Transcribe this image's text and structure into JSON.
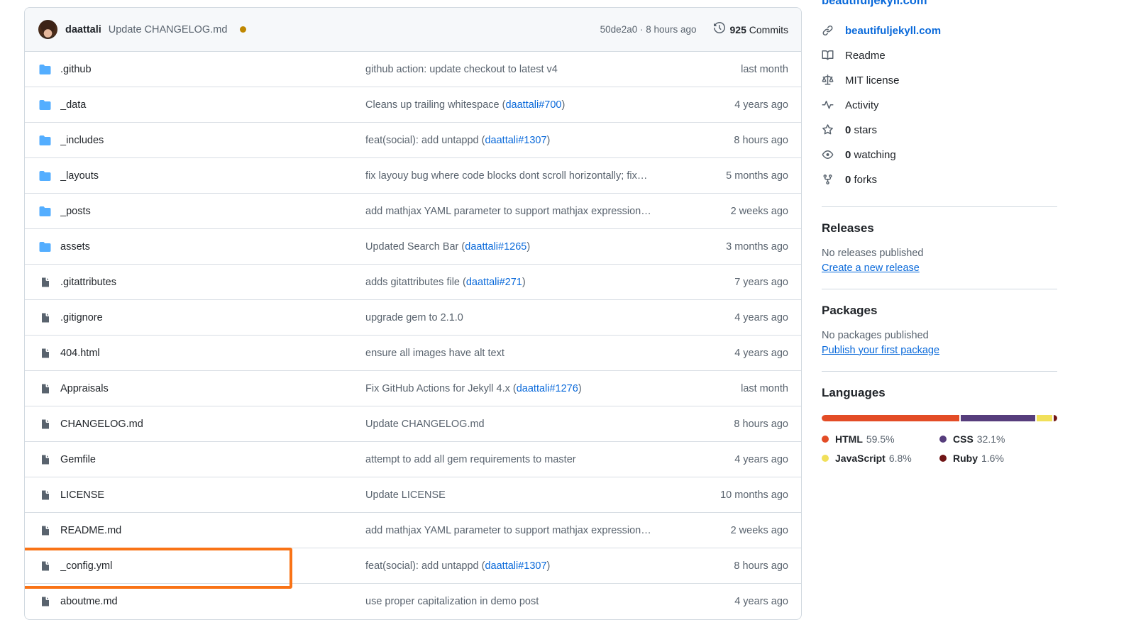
{
  "latest_commit": {
    "author": "daattali",
    "message": "Update CHANGELOG.md",
    "status_dot_color": "#bf8700",
    "sha_and_time": "50de2a0 · 8 hours ago",
    "commits_count": "925",
    "commits_label": "Commits"
  },
  "files": [
    {
      "icon": "folder-icon",
      "name": ".github",
      "message_prefix": "github action: update checkout to latest v4",
      "issue": "",
      "message_suffix": "",
      "time": "last month"
    },
    {
      "icon": "folder-icon",
      "name": "_data",
      "message_prefix": "Cleans up trailing whitespace (",
      "issue": "daattali#700",
      "message_suffix": ")",
      "time": "4 years ago"
    },
    {
      "icon": "folder-icon",
      "name": "_includes",
      "message_prefix": "feat(social): add untappd (",
      "issue": "daattali#1307",
      "message_suffix": ")",
      "time": "8 hours ago"
    },
    {
      "icon": "folder-icon",
      "name": "_layouts",
      "message_prefix": "fix layouy bug where code blocks dont scroll horizontally; fix…",
      "issue": "",
      "message_suffix": "",
      "time": "5 months ago"
    },
    {
      "icon": "folder-icon",
      "name": "_posts",
      "message_prefix": "add mathjax YAML parameter to support mathjax expression…",
      "issue": "",
      "message_suffix": "",
      "time": "2 weeks ago"
    },
    {
      "icon": "folder-icon",
      "name": "assets",
      "message_prefix": "Updated Search Bar (",
      "issue": "daattali#1265",
      "message_suffix": ")",
      "time": "3 months ago"
    },
    {
      "icon": "file-icon",
      "name": ".gitattributes",
      "message_prefix": "adds gitattributes file (",
      "issue": "daattali#271",
      "message_suffix": ")",
      "time": "7 years ago"
    },
    {
      "icon": "file-icon",
      "name": ".gitignore",
      "message_prefix": "upgrade gem to 2.1.0",
      "issue": "",
      "message_suffix": "",
      "time": "4 years ago"
    },
    {
      "icon": "file-icon",
      "name": "404.html",
      "message_prefix": "ensure all images have alt text",
      "issue": "",
      "message_suffix": "",
      "time": "4 years ago"
    },
    {
      "icon": "file-icon",
      "name": "Appraisals",
      "message_prefix": "Fix GitHub Actions for Jekyll 4.x (",
      "issue": "daattali#1276",
      "message_suffix": ")",
      "time": "last month"
    },
    {
      "icon": "file-icon",
      "name": "CHANGELOG.md",
      "message_prefix": "Update CHANGELOG.md",
      "issue": "",
      "message_suffix": "",
      "time": "8 hours ago"
    },
    {
      "icon": "file-icon",
      "name": "Gemfile",
      "message_prefix": "attempt to add all gem requirements to master",
      "issue": "",
      "message_suffix": "",
      "time": "4 years ago"
    },
    {
      "icon": "file-icon",
      "name": "LICENSE",
      "message_prefix": "Update LICENSE",
      "issue": "",
      "message_suffix": "",
      "time": "10 months ago"
    },
    {
      "icon": "file-icon",
      "name": "README.md",
      "message_prefix": "add mathjax YAML parameter to support mathjax expression…",
      "issue": "",
      "message_suffix": "",
      "time": "2 weeks ago"
    },
    {
      "icon": "file-icon",
      "name": "_config.yml",
      "message_prefix": "feat(social): add untappd (",
      "issue": "daattali#1307",
      "message_suffix": ")",
      "time": "8 hours ago",
      "highlighted": true
    },
    {
      "icon": "file-icon",
      "name": "aboutme.md",
      "message_prefix": "use proper capitalization in demo post",
      "issue": "",
      "message_suffix": "",
      "time": "4 years ago"
    }
  ],
  "highlight_color": "#f97316",
  "sidebar": {
    "site_link_top": "beautifuljekyll.com",
    "about_items": [
      {
        "icon": "link-icon",
        "text": "beautifuljekyll.com",
        "is_link": true
      },
      {
        "icon": "book-icon",
        "text": "Readme"
      },
      {
        "icon": "scale-icon",
        "text": "MIT license"
      },
      {
        "icon": "activity-icon",
        "text": "Activity"
      },
      {
        "icon": "star-icon",
        "count": "0",
        "unit": "stars"
      },
      {
        "icon": "eye-icon",
        "count": "0",
        "unit": "watching"
      },
      {
        "icon": "fork-icon",
        "count": "0",
        "unit": "forks"
      }
    ],
    "releases": {
      "title": "Releases",
      "empty_text": "No releases published",
      "action_link": "Create a new release"
    },
    "packages": {
      "title": "Packages",
      "empty_text": "No packages published",
      "action_link": "Publish your first package"
    },
    "languages": {
      "title": "Languages",
      "items": [
        {
          "name": "HTML",
          "percent": "59.5%",
          "value": 59.5,
          "color": "#e34c26"
        },
        {
          "name": "CSS",
          "percent": "32.1%",
          "value": 32.1,
          "color": "#563d7c"
        },
        {
          "name": "JavaScript",
          "percent": "6.8%",
          "value": 6.8,
          "color": "#f1e05a"
        },
        {
          "name": "Ruby",
          "percent": "1.6%",
          "value": 1.6,
          "color": "#701516"
        }
      ]
    }
  }
}
